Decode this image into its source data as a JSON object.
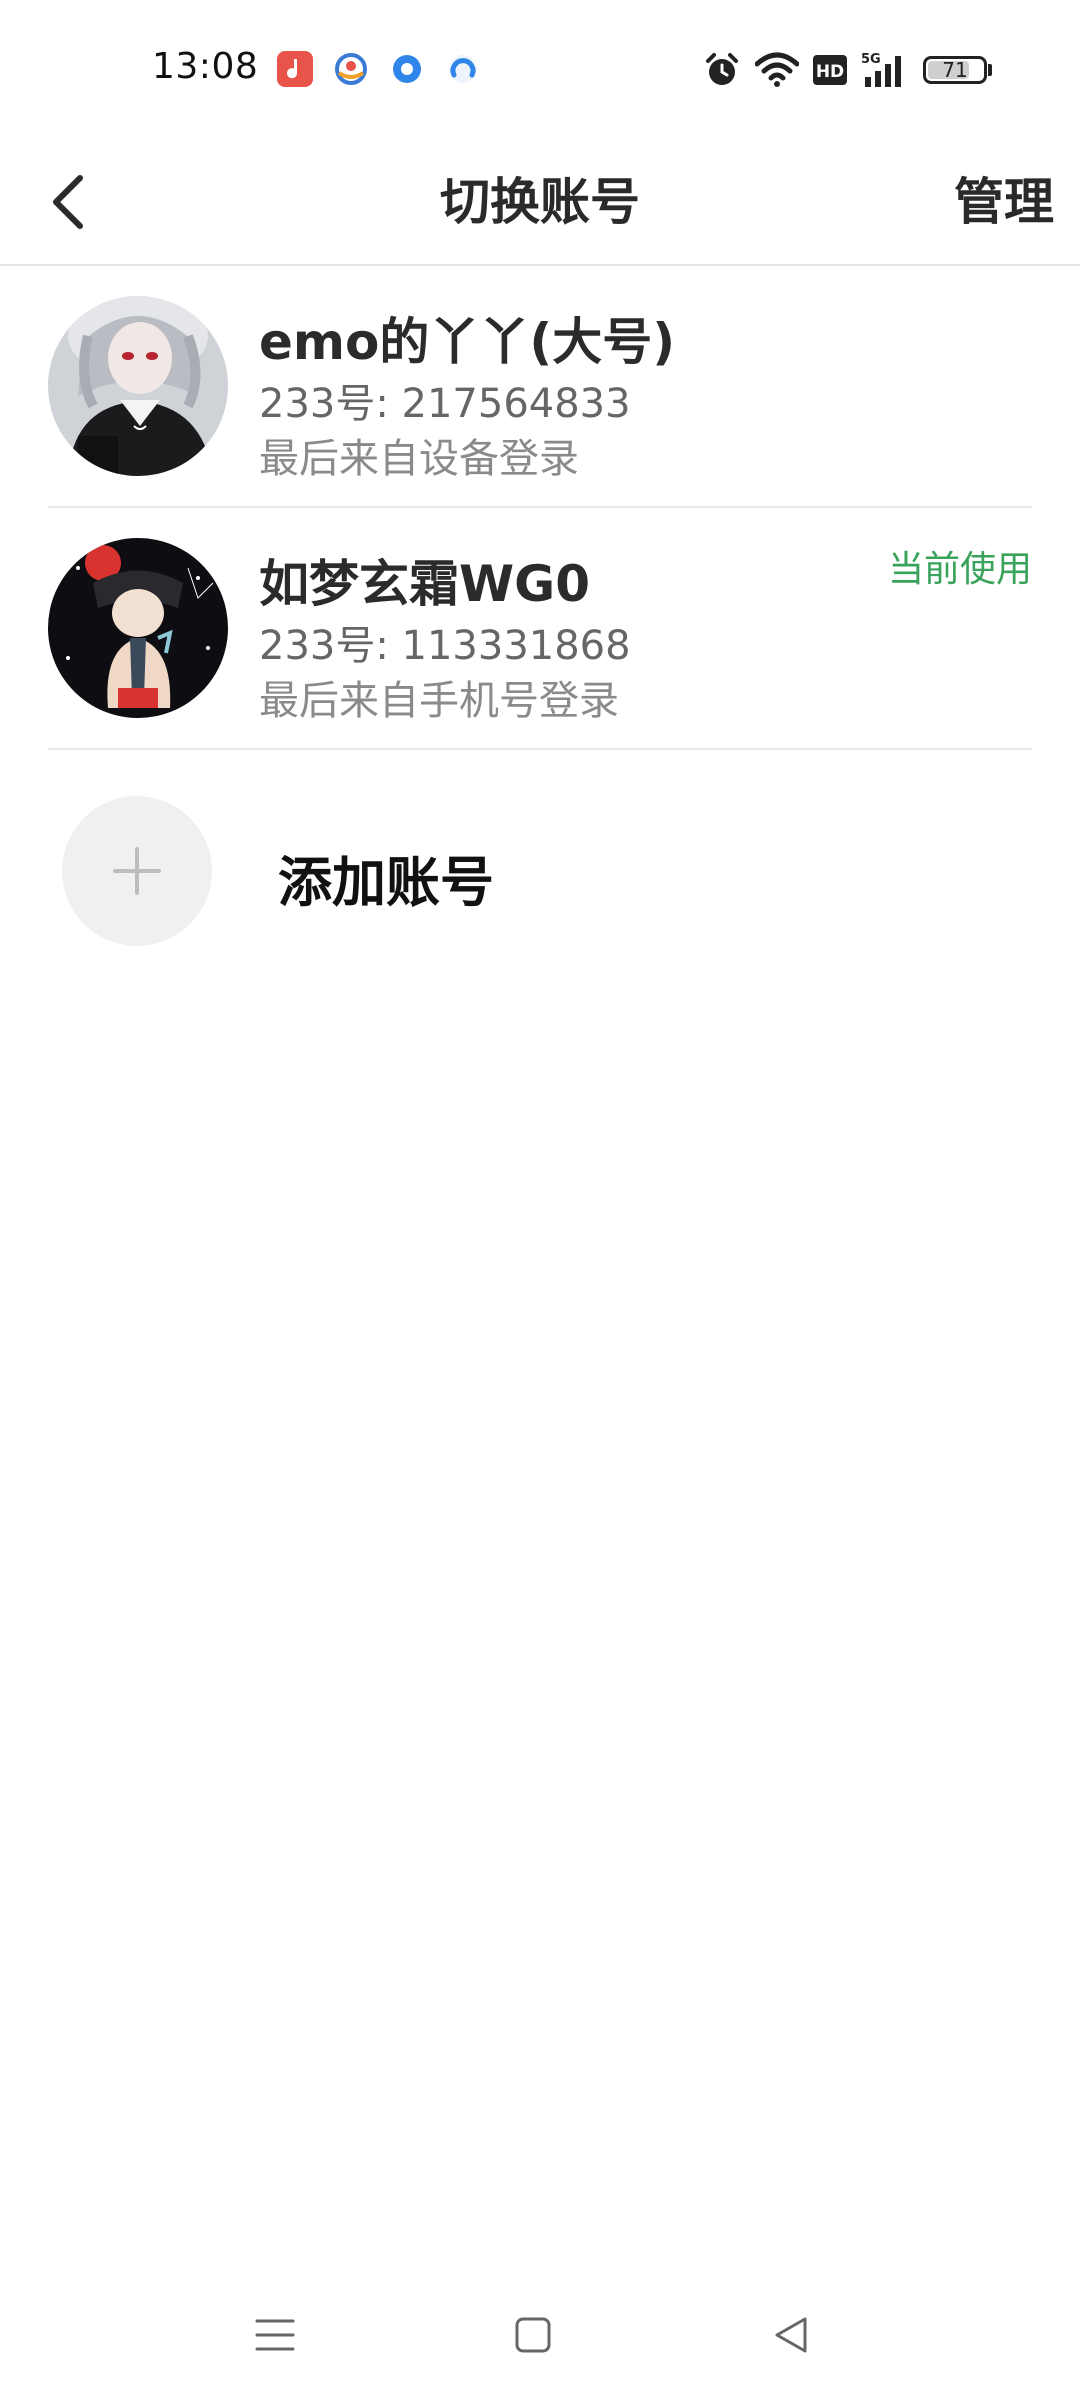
{
  "status_bar": {
    "time": "13:08",
    "notification_icons": [
      "music-app-icon",
      "browser-app-icon",
      "blue-dot-app-icon",
      "qq-browser-app-icon"
    ],
    "system_icons": [
      "alarm-icon",
      "wifi-icon",
      "hd-icon",
      "5g-signal-icon",
      "battery-icon"
    ],
    "hd_label": "HD",
    "network_label": "5G",
    "battery_level": "71"
  },
  "header": {
    "title": "切换账号",
    "manage_label": "管理",
    "back_icon": "back-chevron-icon"
  },
  "accounts": [
    {
      "name": "emo的丫丫(大号)",
      "id_line": "233号: 217564833",
      "login_line": "最后来自设备登录",
      "current": ""
    },
    {
      "name": "如梦玄霜WG0",
      "id_line": "233号: 113331868",
      "login_line": "最后来自手机号登录",
      "current": "当前使用"
    }
  ],
  "add_account": {
    "label": "添加账号",
    "icon": "plus-icon"
  },
  "nav_bar": {
    "icons": [
      "menu-icon",
      "home-icon",
      "back-icon"
    ]
  },
  "colors": {
    "accent_green": "#3aa35b",
    "divider": "#e8e8e8",
    "text_primary": "#2b2b2b",
    "text_secondary": "#666666",
    "text_tertiary": "#8a8a8a"
  }
}
